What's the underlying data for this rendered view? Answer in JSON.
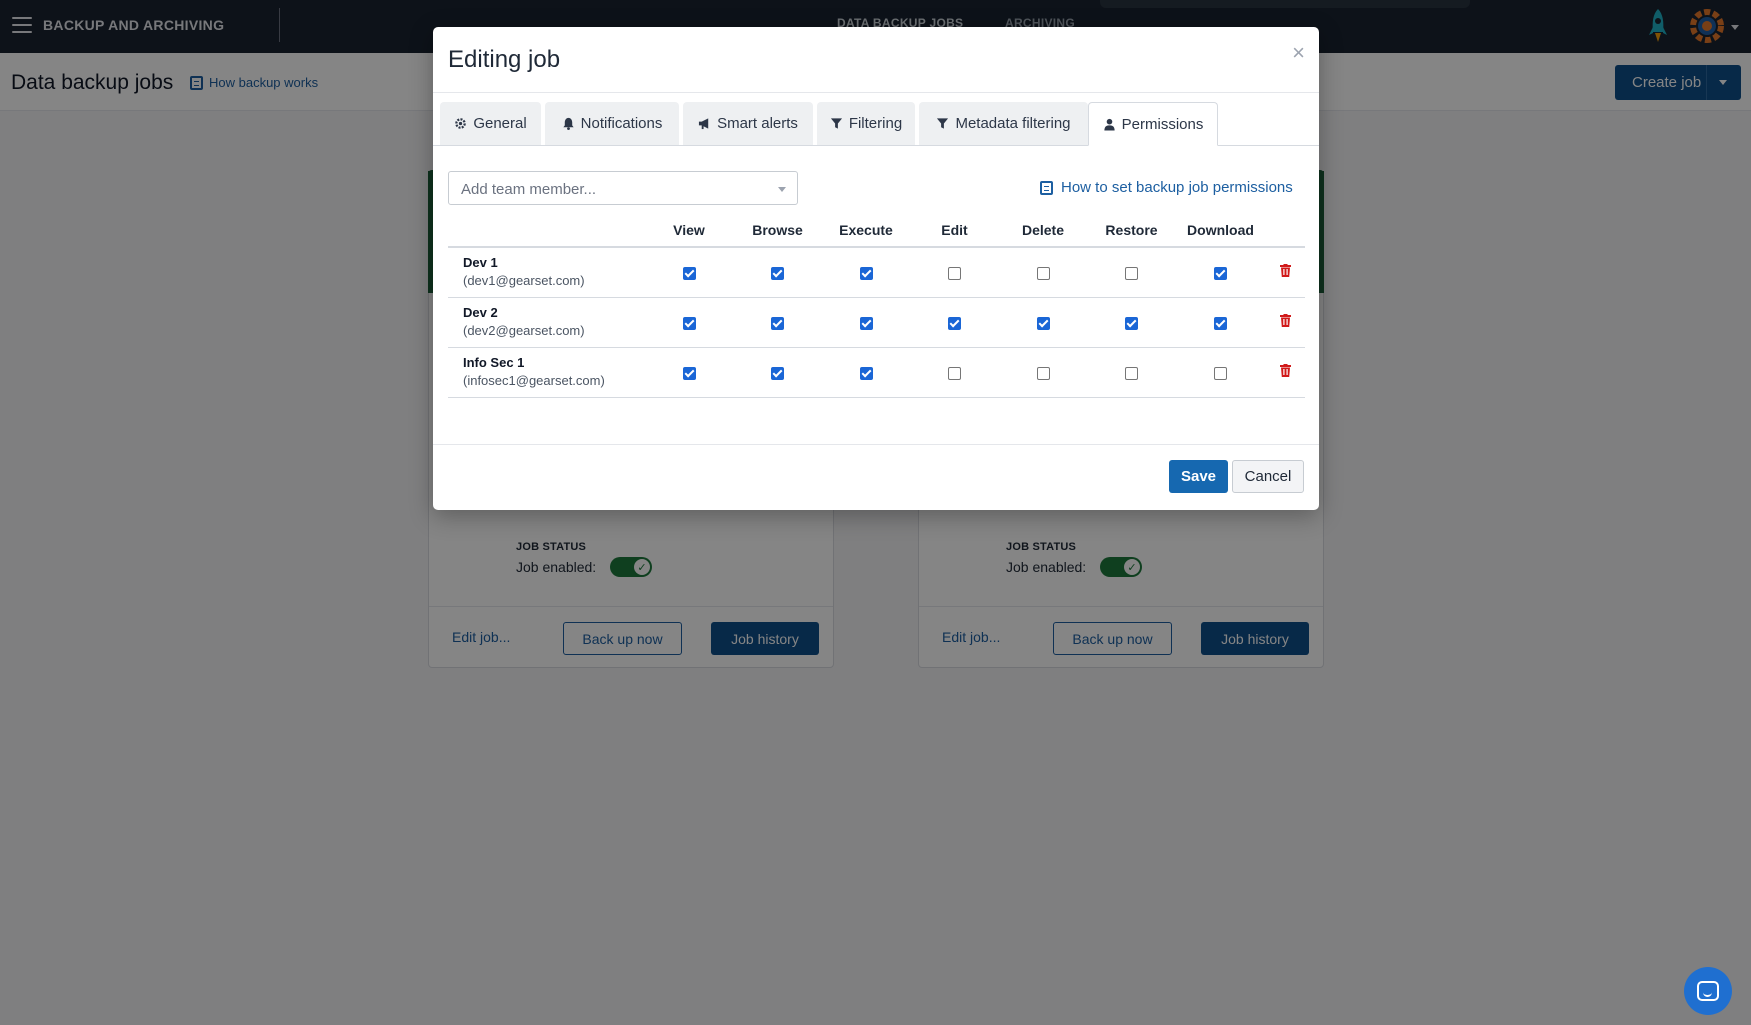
{
  "app": {
    "title": "BACKUP AND ARCHIVING",
    "nav": [
      "DATA BACKUP JOBS",
      "ARCHIVING"
    ]
  },
  "page": {
    "title": "Data backup jobs",
    "how_link": "How backup works",
    "create_label": "Create job"
  },
  "cards": [
    {
      "status_label": "JOB STATUS",
      "status_text": "Job enabled:",
      "edit_label": "Edit job...",
      "backup_label": "Back up now",
      "history_label": "Job history"
    },
    {
      "status_label": "JOB STATUS",
      "status_text": "Job enabled:",
      "edit_label": "Edit job...",
      "backup_label": "Back up now",
      "history_label": "Job history"
    }
  ],
  "modal": {
    "title": "Editing job",
    "close": "×",
    "tabs": [
      {
        "label": "General",
        "icon": "gear-icon"
      },
      {
        "label": "Notifications",
        "icon": "bell-icon"
      },
      {
        "label": "Smart alerts",
        "icon": "megaphone-icon"
      },
      {
        "label": "Filtering",
        "icon": "filter-icon"
      },
      {
        "label": "Metadata filtering",
        "icon": "filter-icon"
      },
      {
        "label": "Permissions",
        "icon": "user-icon",
        "active": true
      }
    ],
    "member_placeholder": "Add team member...",
    "perm_link": "How to set backup job permissions",
    "columns": [
      "View",
      "Browse",
      "Execute",
      "Edit",
      "Delete",
      "Restore",
      "Download"
    ],
    "members": [
      {
        "name": "Dev 1",
        "email": "(dev1@gearset.com)",
        "perms": [
          true,
          true,
          true,
          false,
          false,
          false,
          true
        ]
      },
      {
        "name": "Dev 2",
        "email": "(dev2@gearset.com)",
        "perms": [
          true,
          true,
          true,
          true,
          true,
          true,
          true
        ]
      },
      {
        "name": "Info Sec 1",
        "email": "(infosec1@gearset.com)",
        "perms": [
          true,
          true,
          true,
          false,
          false,
          false,
          false
        ]
      }
    ],
    "save_label": "Save",
    "cancel_label": "Cancel"
  },
  "colors": {
    "primary": "#0f4f8a",
    "accent": "#1b5e3b",
    "danger": "#d11a1a",
    "checkbox": "#1a66d6"
  }
}
